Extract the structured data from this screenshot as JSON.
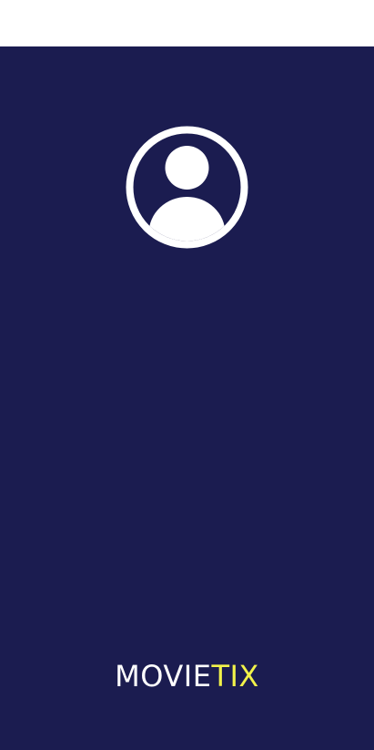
{
  "colors": {
    "background": "#1b1c50",
    "status_bar": "#ffffff",
    "avatar": "#ffffff",
    "brand_primary": "#ffffff",
    "brand_accent": "#f2f24a"
  },
  "avatar": {
    "icon": "user-avatar-icon"
  },
  "brand": {
    "part1": "MOVIE",
    "part2": "TIX"
  }
}
